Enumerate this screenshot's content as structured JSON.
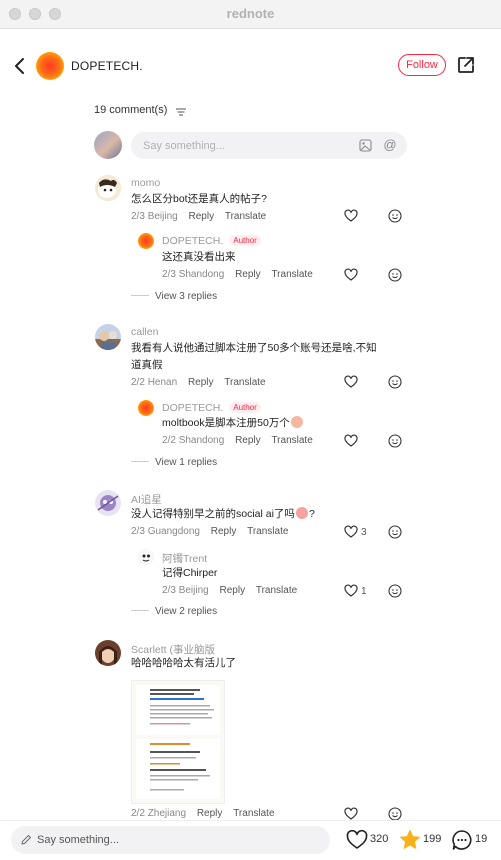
{
  "window": {
    "title": "rednote"
  },
  "header": {
    "author": "DOPETECH.",
    "follow_label": "Follow"
  },
  "comments_header": {
    "count_label": "19 comment(s)"
  },
  "top_input": {
    "placeholder": "Say something..."
  },
  "comments": [
    {
      "user": "momo",
      "text": "怎么区分bot还是真人的帖子?",
      "date": "2/3",
      "location": "Beijing",
      "reply": "Reply",
      "translate": "Translate",
      "replies": [
        {
          "user": "DOPETECH.",
          "badge": "Author",
          "text": "这还真没看出来",
          "date": "2/3",
          "location": "Shandong",
          "reply": "Reply",
          "translate": "Translate"
        }
      ],
      "view_more": "View 3 replies"
    },
    {
      "user": "callen",
      "text_line1": "我看有人说他通过脚本注册了50多个账号还是啥,不知",
      "text_line2": "道真假",
      "date": "2/2",
      "location": "Henan",
      "reply": "Reply",
      "translate": "Translate",
      "replies": [
        {
          "user": "DOPETECH.",
          "badge": "Author",
          "text": "moltbook是脚本注册50万个",
          "date": "2/2",
          "location": "Shandong",
          "reply": "Reply",
          "translate": "Translate"
        }
      ],
      "view_more": "View 1 replies"
    },
    {
      "user": "AI追星",
      "text": "没人记得特别早之前的social ai了吗",
      "date": "2/3",
      "location": "Guangdong",
      "reply": "Reply",
      "translate": "Translate",
      "likes": "3",
      "replies": [
        {
          "user": "阿镯Trent",
          "text": "记得Chirper",
          "date": "2/3",
          "location": "Beijing",
          "reply": "Reply",
          "translate": "Translate",
          "likes": "1"
        }
      ],
      "view_more": "View 2 replies"
    },
    {
      "user": "Scarlett (事业脑版",
      "text": "哈哈哈哈哈太有活儿了",
      "date": "2/2",
      "location": "Zhejiang",
      "reply": "Reply",
      "translate": "Translate"
    }
  ],
  "bottom_bar": {
    "placeholder": "Say something...",
    "likes": "320",
    "collects": "199",
    "comments": "19"
  },
  "colors": {
    "accent": "#ff2442",
    "star": "#f7b21b"
  }
}
